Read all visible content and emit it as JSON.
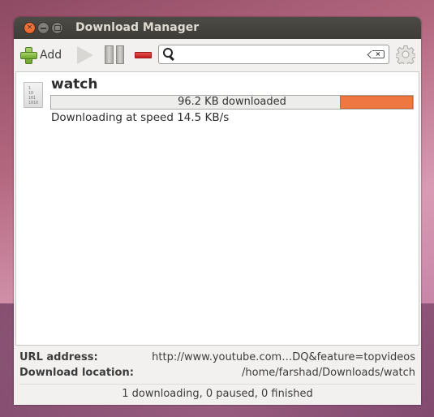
{
  "window": {
    "title": "Download Manager",
    "controls": {
      "close": "×",
      "minimize": "–",
      "maximize": "□"
    }
  },
  "toolbar": {
    "add_label": "Add",
    "icons": {
      "add": "plus-icon",
      "start": "play-icon",
      "pause": "pause-icon",
      "remove": "remove-icon",
      "search": "search-icon",
      "clear": "clear-icon",
      "settings": "gear-icon"
    },
    "search": {
      "value": "",
      "placeholder": ""
    }
  },
  "downloads": [
    {
      "name": "watch",
      "file_icon_lines": [
        "1",
        "10",
        "101",
        "1010"
      ],
      "progress_label": "96.2 KB downloaded",
      "progress_mode": "indeterminate",
      "status": "Downloading at speed 14.5 KB/s"
    }
  ],
  "details": {
    "url_label": "URL address:",
    "url_value": "http://www.youtube.com…DQ&feature=topvideos",
    "location_label": "Download location:",
    "location_value": "/home/farshad/Downloads/watch"
  },
  "statusbar": {
    "text": "1 downloading, 0 paused, 0 finished"
  },
  "colors": {
    "accent_progress": "#ef7842",
    "close_button": "#e9632a",
    "titlebar": "#3f3e39"
  }
}
